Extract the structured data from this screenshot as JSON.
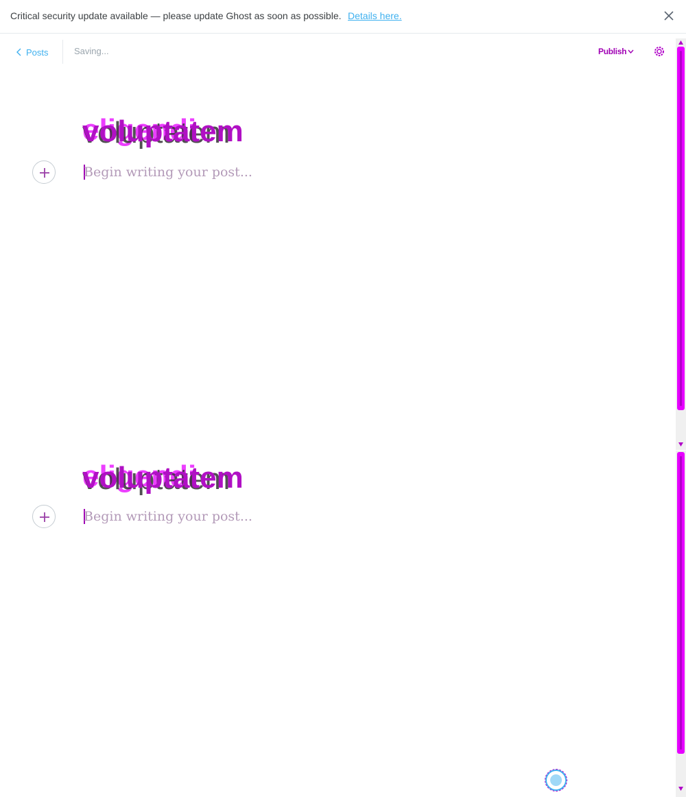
{
  "banner": {
    "message": "Critical security update available — please update Ghost as soon as possible.",
    "link_text": "Details here.",
    "close_icon": "close-icon"
  },
  "editor": {
    "back_label": "Posts",
    "status": "Saving...",
    "publish_label": "Publish",
    "settings_icon": "gear-icon",
    "title_text": "voluptatem",
    "title_overlay": "eligendi",
    "body_placeholder": "Begin writing your post...",
    "add_card_icon": "plus-icon"
  },
  "colors": {
    "accent": "#3eb0ef",
    "highlight": "#b010c4",
    "overlay": "#e600ff"
  }
}
